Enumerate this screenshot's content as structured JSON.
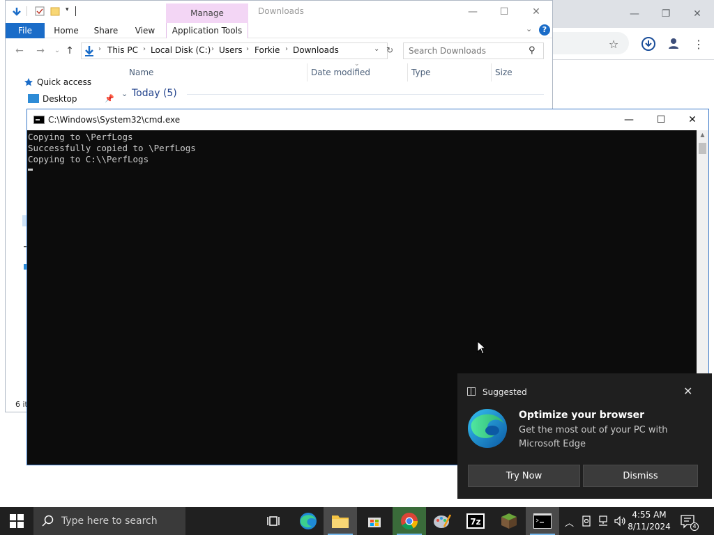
{
  "explorer": {
    "title": "Downloads",
    "manage_tab": "Manage",
    "ribbon_tabs": [
      "File",
      "Home",
      "Share",
      "View",
      "Application Tools"
    ],
    "breadcrumb": [
      "This PC",
      "Local Disk (C:)",
      "Users",
      "Forkie",
      "Downloads"
    ],
    "search_placeholder": "Search Downloads",
    "columns": [
      "Name",
      "Date modified",
      "Type",
      "Size"
    ],
    "nav": {
      "quick_access": "Quick access",
      "desktop": "Desktop"
    },
    "group_label": "Today (5)",
    "status_text": "6 it"
  },
  "cmd": {
    "title": "C:\\Windows\\System32\\cmd.exe",
    "lines": [
      "Copying to \\PerfLogs",
      "Successfully copied to \\PerfLogs",
      "Copying to C:\\\\PerfLogs"
    ]
  },
  "toast": {
    "header": "Suggested",
    "headline": "Optimize your browser",
    "body": "Get the most out of your PC with Microsoft Edge",
    "try_now": "Try Now",
    "dismiss": "Dismiss"
  },
  "taskbar": {
    "search_placeholder": "Type here to search",
    "time": "4:55 AM",
    "date": "8/11/2024",
    "notification_count": "4",
    "apps": [
      "task-view",
      "edge",
      "file-explorer",
      "microsoft-store",
      "chrome",
      "paint",
      "7-zip",
      "minecraft",
      "command-prompt"
    ]
  },
  "colors": {
    "accent": "#1a6cc8",
    "manage_tab": "#f3d6f5",
    "console_bg": "#0c0c0c",
    "console_text": "#cccccc",
    "toast_bg": "#1f1f1f",
    "taskbar_bg": "#202020"
  }
}
